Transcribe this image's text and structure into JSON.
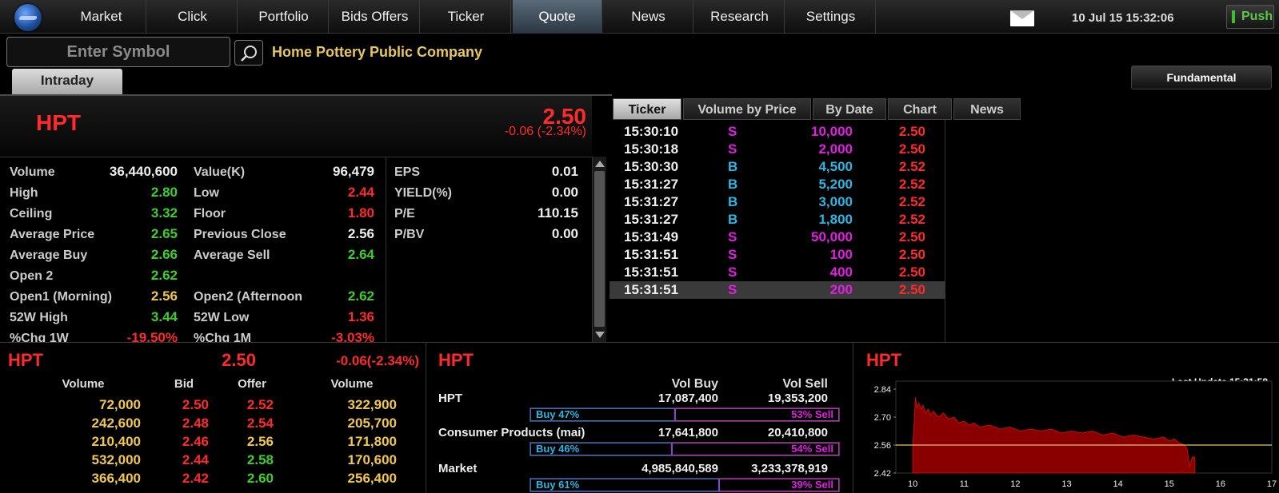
{
  "nav": {
    "items": [
      "Market",
      "Click",
      "Portfolio",
      "Bids Offers",
      "Ticker",
      "Quote",
      "News",
      "Research",
      "Settings"
    ],
    "active": "Quote",
    "datetime": "10 Jul 15   15:32:06",
    "push_label": "Push"
  },
  "search": {
    "placeholder": "Enter Symbol"
  },
  "company_name": "Home Pottery Public Company",
  "intraday_tab": "Intraday",
  "fundamental_label": "Fundamental",
  "quote": {
    "symbol": "HPT",
    "last": "2.50",
    "change": "-0.06 (-2.34%)"
  },
  "stats_left": [
    {
      "label": "Volume",
      "value": "36,440,600",
      "color": "white"
    },
    {
      "label": "High",
      "value": "2.80",
      "color": "green"
    },
    {
      "label": "Ceiling",
      "value": "3.32",
      "color": "green"
    },
    {
      "label": "Average Price",
      "value": "2.65",
      "color": "green"
    },
    {
      "label": "Average Buy",
      "value": "2.66",
      "color": "green"
    },
    {
      "label": "Open 2",
      "value": "2.62",
      "color": "green"
    },
    {
      "label": "Open1 (Morning)",
      "value": "2.56",
      "color": "yellow"
    },
    {
      "label": "52W High",
      "value": "3.44",
      "color": "green"
    },
    {
      "label": "%Chg 1W",
      "value": "-19.50%",
      "color": "red"
    }
  ],
  "stats_mid": [
    {
      "label": "Value(K)",
      "value": "96,479",
      "color": "white"
    },
    {
      "label": "Low",
      "value": "2.44",
      "color": "red"
    },
    {
      "label": "Floor",
      "value": "1.80",
      "color": "red"
    },
    {
      "label": "Previous Close",
      "value": "2.56",
      "color": "white"
    },
    {
      "label": "Average Sell",
      "value": "2.64",
      "color": "green"
    },
    {
      "label": "",
      "value": "",
      "color": "white"
    },
    {
      "label": "Open2 (Afternoon",
      "value": "2.62",
      "color": "green"
    },
    {
      "label": "52W Low",
      "value": "1.36",
      "color": "red"
    },
    {
      "label": "%Chg 1M",
      "value": "-3.03%",
      "color": "red"
    }
  ],
  "stats_right": [
    {
      "label": "EPS",
      "value": "0.01"
    },
    {
      "label": "YIELD(%)",
      "value": "0.00"
    },
    {
      "label": "P/E",
      "value": "110.15"
    },
    {
      "label": "P/BV",
      "value": "0.00"
    }
  ],
  "right_tabs": [
    "Ticker",
    "Volume by Price",
    "By Date",
    "Chart",
    "News"
  ],
  "ticks": [
    {
      "time": "15:30:10",
      "side": "S",
      "vol": "10,000",
      "price": "2.50"
    },
    {
      "time": "15:30:18",
      "side": "S",
      "vol": "2,000",
      "price": "2.50"
    },
    {
      "time": "15:30:30",
      "side": "B",
      "vol": "4,500",
      "price": "2.52"
    },
    {
      "time": "15:31:27",
      "side": "B",
      "vol": "5,200",
      "price": "2.52"
    },
    {
      "time": "15:31:27",
      "side": "B",
      "vol": "3,000",
      "price": "2.52"
    },
    {
      "time": "15:31:27",
      "side": "B",
      "vol": "1,800",
      "price": "2.52"
    },
    {
      "time": "15:31:49",
      "side": "S",
      "vol": "50,000",
      "price": "2.50"
    },
    {
      "time": "15:31:51",
      "side": "S",
      "vol": "100",
      "price": "2.50"
    },
    {
      "time": "15:31:51",
      "side": "S",
      "vol": "400",
      "price": "2.50"
    },
    {
      "time": "15:31:51",
      "side": "S",
      "vol": "200",
      "price": "2.50"
    }
  ],
  "bidoffer": {
    "title": "HPT",
    "last": "2.50",
    "change": "-0.06(-2.34%)",
    "headers": [
      "Volume",
      "Bid",
      "Offer",
      "Volume"
    ],
    "rows": [
      {
        "bid_vol": "72,000",
        "bid": "2.50",
        "offer": "2.52",
        "offer_vol": "322,900",
        "offer_color": "red"
      },
      {
        "bid_vol": "242,600",
        "bid": "2.48",
        "offer": "2.54",
        "offer_vol": "205,700",
        "offer_color": "red"
      },
      {
        "bid_vol": "210,400",
        "bid": "2.46",
        "offer": "2.56",
        "offer_vol": "171,800",
        "offer_color": "yellow"
      },
      {
        "bid_vol": "532,000",
        "bid": "2.44",
        "offer": "2.58",
        "offer_vol": "170,600",
        "offer_color": "green"
      },
      {
        "bid_vol": "366,400",
        "bid": "2.42",
        "offer": "2.60",
        "offer_vol": "256,400",
        "offer_color": "green"
      }
    ]
  },
  "volbs": {
    "title": "HPT",
    "headers": [
      "Vol Buy",
      "Vol Sell"
    ],
    "rows": [
      {
        "name": "HPT",
        "buy": "17,087,400",
        "sell": "19,353,200",
        "buy_pct": 47,
        "buy_label": "Buy  47%",
        "sell_label": "53%  Sell"
      },
      {
        "name": "Consumer Products (mai)",
        "buy": "17,641,800",
        "sell": "20,410,800",
        "buy_pct": 46,
        "buy_label": "Buy  46%",
        "sell_label": "54%  Sell"
      },
      {
        "name": "Market",
        "buy": "4,985,840,589",
        "sell": "3,233,378,919",
        "buy_pct": 61,
        "buy_label": "Buy  61%",
        "sell_label": "39%  Sell"
      }
    ]
  },
  "chart_panel": {
    "title": "HPT",
    "last_update": "Last Update 15:31:58"
  },
  "chart_data": {
    "type": "area",
    "title": "",
    "xlabel": "",
    "ylabel": "",
    "x_ticks": [
      "10",
      "11",
      "12",
      "13",
      "14",
      "15",
      "16",
      "17"
    ],
    "y_ticks": [
      "2.84",
      "2.70",
      "2.56",
      "2.42"
    ],
    "ylim": [
      2.42,
      2.84
    ],
    "xlim": [
      9.67,
      17
    ],
    "reference_line": 2.56,
    "series": [
      {
        "x": [
          10.0,
          10.03,
          10.05,
          10.08,
          10.12,
          10.17,
          10.2,
          10.25,
          10.3,
          10.35,
          10.4,
          10.5,
          10.6,
          10.7,
          10.8,
          10.9,
          11.0,
          11.1,
          11.2,
          11.3,
          11.5,
          11.7,
          11.9,
          12.1,
          12.3,
          12.5,
          12.7,
          12.9,
          13.1,
          13.3,
          13.5,
          13.7,
          13.9,
          14.1,
          14.3,
          14.5,
          14.7,
          14.9,
          15.0,
          15.1,
          15.2,
          15.3,
          15.35,
          15.4,
          15.45,
          15.5
        ],
        "y": [
          2.56,
          2.68,
          2.8,
          2.75,
          2.77,
          2.74,
          2.76,
          2.72,
          2.74,
          2.71,
          2.73,
          2.7,
          2.72,
          2.69,
          2.7,
          2.67,
          2.68,
          2.66,
          2.67,
          2.65,
          2.66,
          2.64,
          2.65,
          2.63,
          2.64,
          2.63,
          2.64,
          2.62,
          2.63,
          2.62,
          2.63,
          2.61,
          2.62,
          2.6,
          2.61,
          2.6,
          2.59,
          2.6,
          2.58,
          2.59,
          2.57,
          2.56,
          2.54,
          2.45,
          2.5,
          2.5
        ]
      }
    ]
  }
}
